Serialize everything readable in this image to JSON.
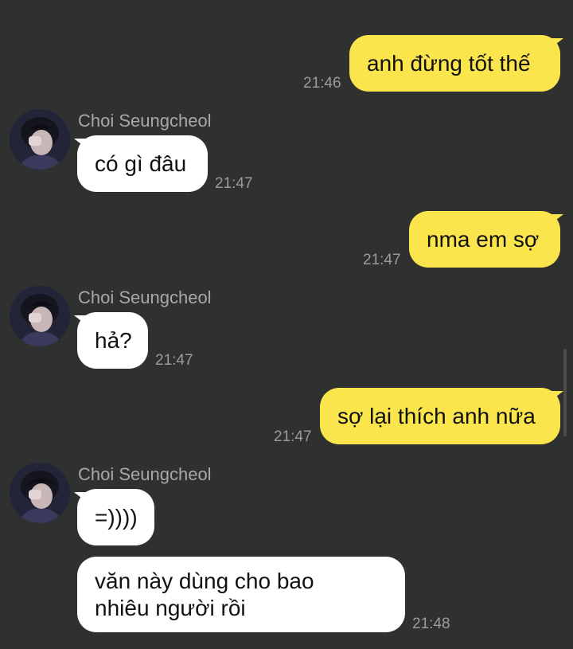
{
  "contact": {
    "name": "Choi Seungcheol"
  },
  "messages": [
    {
      "direction": "out",
      "text": "anh đừng tốt thế",
      "time": "21:46"
    },
    {
      "direction": "in",
      "sender": "Choi Seungcheol",
      "text": "có gì đâu",
      "time": "21:47"
    },
    {
      "direction": "out",
      "text": "nma em sợ",
      "time": "21:47"
    },
    {
      "direction": "in",
      "sender": "Choi Seungcheol",
      "text": "hả?",
      "time": "21:47"
    },
    {
      "direction": "out",
      "text": "sợ lại thích anh nữa",
      "time": "21:47"
    },
    {
      "direction": "in",
      "sender": "Choi Seungcheol",
      "text": "=))))",
      "time": ""
    },
    {
      "direction": "in",
      "text": "văn này dùng cho bao nhiêu người rồi",
      "time": "21:48"
    }
  ],
  "colors": {
    "background": "#2f3130",
    "outgoing_bubble": "#fbe54d",
    "incoming_bubble": "#ffffff",
    "timestamp": "#9a9c9b",
    "sender_name": "#a7a9a8"
  },
  "icons": {
    "avatar": "profile-photo"
  }
}
